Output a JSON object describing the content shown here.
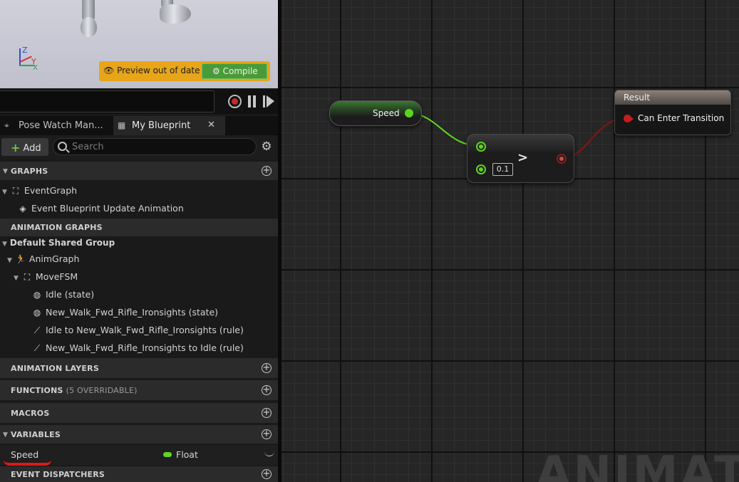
{
  "viewport": {
    "preview_text": "Preview out of date",
    "compile_label": "Compile",
    "axis_labels": {
      "z": "Z",
      "y": "Y",
      "x": "X"
    }
  },
  "tabs": [
    {
      "label": "Pose Watch Man..."
    },
    {
      "label": "My Blueprint"
    }
  ],
  "toolbar": {
    "add_label": "Add",
    "search_placeholder": "Search"
  },
  "sections": {
    "graphs": "GRAPHS",
    "animation_graphs": "ANIMATION GRAPHS",
    "animation_layers": "ANIMATION LAYERS",
    "functions": "FUNCTIONS",
    "functions_sub": "(5 OVERRIDABLE)",
    "macros": "MACROS",
    "variables": "VARIABLES",
    "event_dispatchers": "EVENT DISPATCHERS"
  },
  "tree": {
    "event_graph": "EventGraph",
    "event_update": "Event Blueprint Update Animation",
    "default_group": "Default Shared Group",
    "anim_graph": "AnimGraph",
    "move_fsm": "MoveFSM",
    "idle_state": "Idle (state)",
    "walk_state": "New_Walk_Fwd_Rifle_Ironsights (state)",
    "rule_idle_to_walk": "Idle to New_Walk_Fwd_Rifle_Ironsights (rule)",
    "rule_walk_to_idle": "New_Walk_Fwd_Rifle_Ironsights to Idle (rule)"
  },
  "variable": {
    "name": "Speed",
    "type": "Float",
    "type_color": "#62d320"
  },
  "graph": {
    "speed_node_label": "Speed",
    "compare_operator": ">",
    "compare_literal": "0.1",
    "result_title": "Result",
    "result_pin_label": "Can Enter Transition",
    "watermark": "ANIMATION"
  },
  "colors": {
    "float_pin": "#5fd41f",
    "bool_pin": "#c51d1d",
    "warning_bar": "#e7a51a",
    "compile_button": "#4a9a3a"
  }
}
